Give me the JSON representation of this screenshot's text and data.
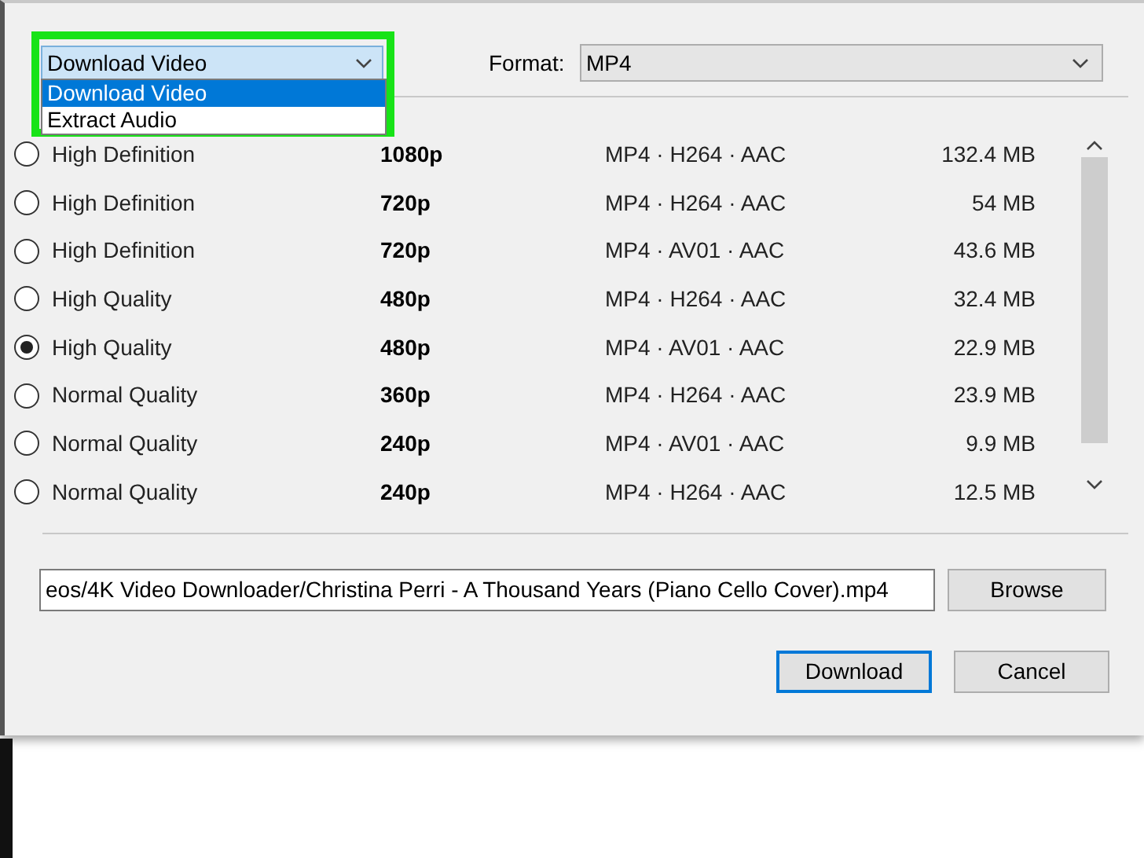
{
  "mode_select": {
    "value": "Download Video",
    "expanded": true,
    "highlighted": true,
    "options": [
      {
        "label": "Download Video",
        "selected": true
      },
      {
        "label": "Extract Audio",
        "selected": false
      }
    ]
  },
  "format": {
    "label": "Format:",
    "value": "MP4"
  },
  "options": [
    {
      "quality": "High Definition",
      "resolution": "1080p",
      "codec": "MP4 · H264 · AAC",
      "size": "132.4 MB",
      "selected": false
    },
    {
      "quality": "High Definition",
      "resolution": "720p",
      "codec": "MP4 · H264 · AAC",
      "size": "54 MB",
      "selected": false
    },
    {
      "quality": "High Definition",
      "resolution": "720p",
      "codec": "MP4 · AV01 · AAC",
      "size": "43.6 MB",
      "selected": false
    },
    {
      "quality": "High Quality",
      "resolution": "480p",
      "codec": "MP4 · H264 · AAC",
      "size": "32.4 MB",
      "selected": false
    },
    {
      "quality": "High Quality",
      "resolution": "480p",
      "codec": "MP4 · AV01 · AAC",
      "size": "22.9 MB",
      "selected": true
    },
    {
      "quality": "Normal Quality",
      "resolution": "360p",
      "codec": "MP4 · H264 · AAC",
      "size": "23.9 MB",
      "selected": false
    },
    {
      "quality": "Normal Quality",
      "resolution": "240p",
      "codec": "MP4 · AV01 · AAC",
      "size": "9.9 MB",
      "selected": false
    },
    {
      "quality": "Normal Quality",
      "resolution": "240p",
      "codec": "MP4 · H264 · AAC",
      "size": "12.5 MB",
      "selected": false
    }
  ],
  "save_path": {
    "value": "eos/4K Video Downloader/Christina Perri - A Thousand Years (Piano Cello Cover).mp4"
  },
  "buttons": [
    {
      "label": "Browse",
      "kind": "browse"
    },
    {
      "label": "Download",
      "kind": "default"
    },
    {
      "label": "Cancel",
      "kind": "normal"
    }
  ]
}
